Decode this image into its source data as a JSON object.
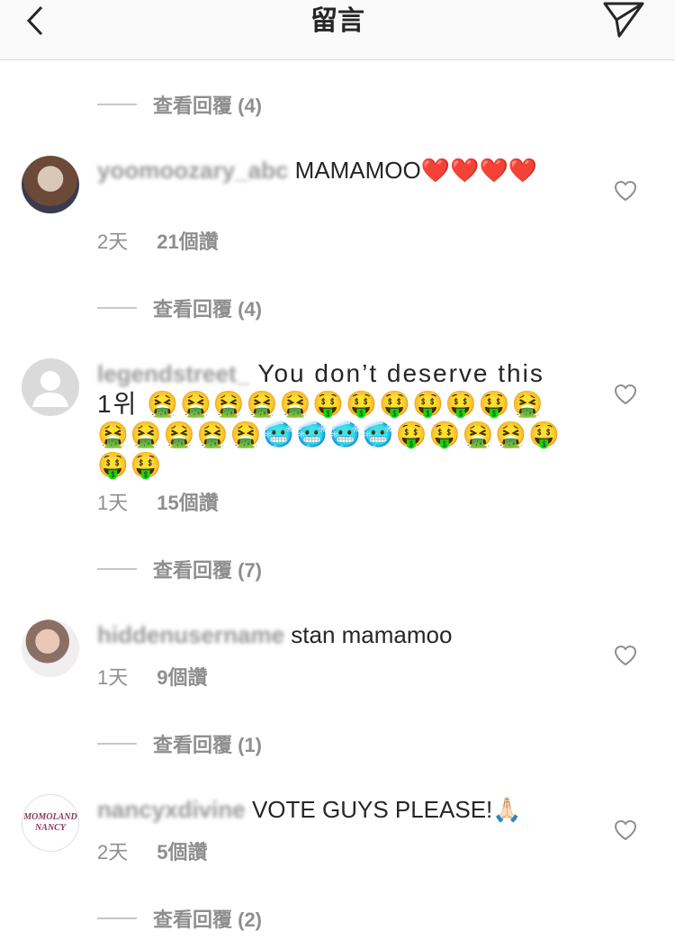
{
  "header": {
    "title": "留言"
  },
  "replies": [
    {
      "label": "查看回覆 (4)"
    },
    {
      "label": "查看回覆 (4)"
    },
    {
      "label": "查看回覆 (7)"
    },
    {
      "label": "查看回覆 (1)"
    },
    {
      "label": "查看回覆 (2)"
    }
  ],
  "comments": [
    {
      "username": "yoomoozary_abc",
      "text": " MAMAMOO❤️❤️❤️❤️",
      "time": "2天",
      "likes": "21個讚"
    },
    {
      "username": "legendstreet_",
      "text": " You don’t deserve this 1위 🤮🤮🤮🤮🤮🤑🤑🤑🤑🤑🤑🤮🤮🤮🤮🤮🤮🥶🥶🥶🥶🤑🤑🤮🤮🤑🤑🤑",
      "time": "1天",
      "likes": "15個讚"
    },
    {
      "username": "hiddenusername",
      "text": " stan mamamoo",
      "time": "1天",
      "likes": "9個讚"
    },
    {
      "username": "nancyxdivine",
      "text": " VOTE GUYS PLEASE!🙏🏻",
      "time": "2天",
      "likes": "5個讚",
      "avatar_text": [
        "MOMOLAND",
        "NANCY"
      ]
    }
  ]
}
